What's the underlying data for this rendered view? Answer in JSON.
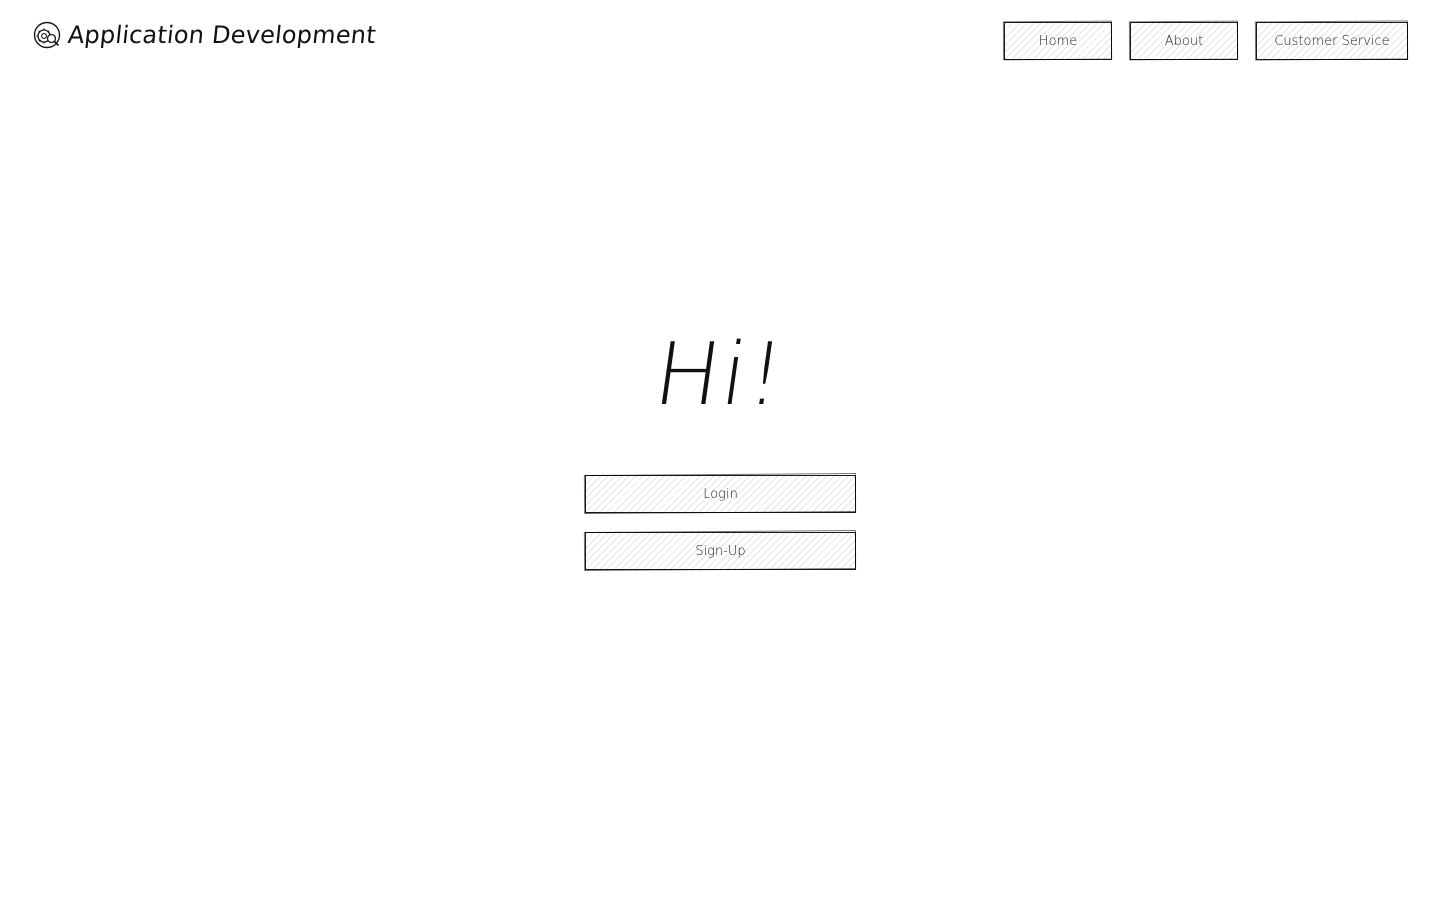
{
  "header": {
    "brand_icon": "gear-search-icon",
    "title": "Application Development",
    "nav": [
      {
        "label": "Home"
      },
      {
        "label": "About"
      },
      {
        "label": "Customer Service"
      }
    ]
  },
  "main": {
    "greeting": "Hi!",
    "buttons": {
      "login": "Login",
      "signup": "Sign-Up"
    }
  },
  "colors": {
    "ink": "#1a1a1a",
    "background": "#ffffff"
  }
}
